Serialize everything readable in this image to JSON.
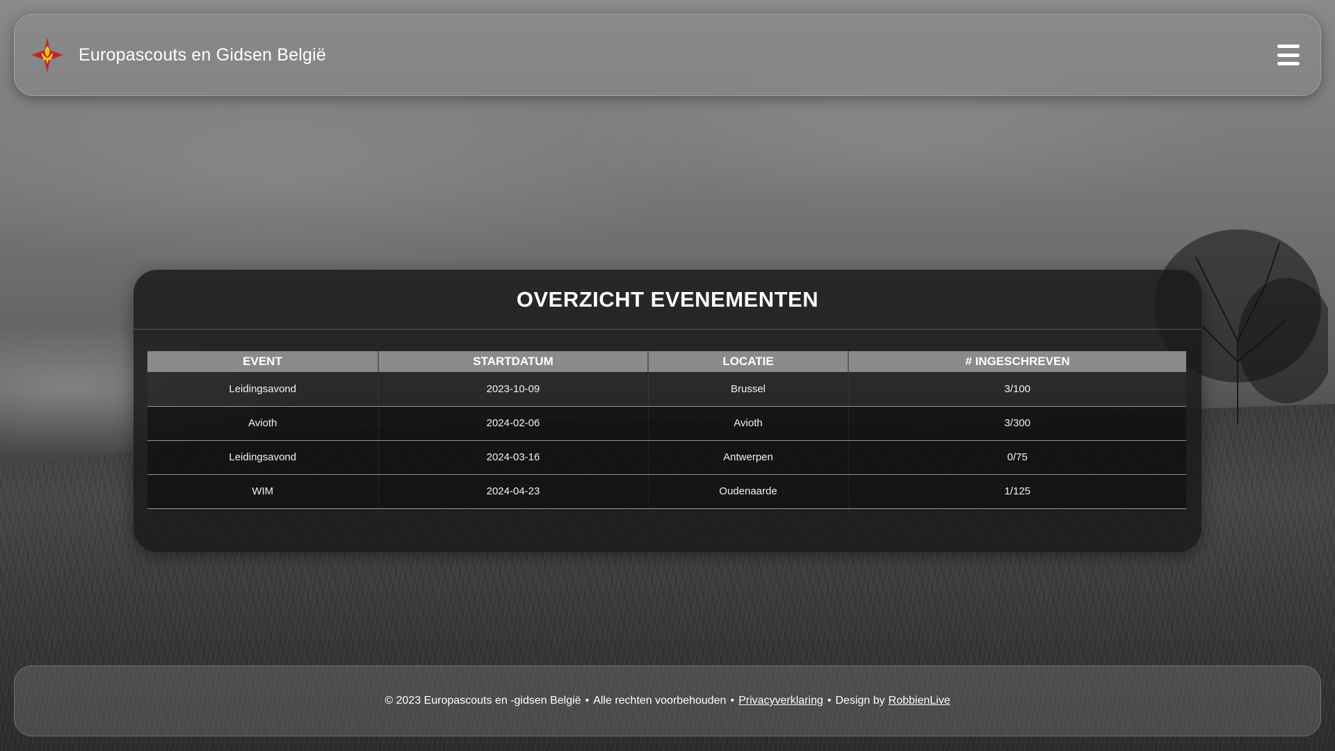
{
  "header": {
    "site_title": "Europascouts en Gidsen België",
    "logo_icon": "fleur-de-lis-star-icon",
    "menu_icon": "hamburger-menu-icon"
  },
  "events": {
    "title": "OVERZICHT EVENEMENTEN",
    "columns": [
      "EVENT",
      "STARTDATUM",
      "LOCATIE",
      "# INGESCHREVEN"
    ],
    "rows": [
      {
        "event": "Leidingsavond",
        "startdatum": "2023-10-09",
        "locatie": "Brussel",
        "ingeschreven": "3/100"
      },
      {
        "event": "Avioth",
        "startdatum": "2024-02-06",
        "locatie": "Avioth",
        "ingeschreven": "3/300"
      },
      {
        "event": "Leidingsavond",
        "startdatum": "2024-03-16",
        "locatie": "Antwerpen",
        "ingeschreven": "0/75"
      },
      {
        "event": "WIM",
        "startdatum": "2024-04-23",
        "locatie": "Oudenaarde",
        "ingeschreven": "1/125"
      }
    ]
  },
  "footer": {
    "copyright": "© 2023 Europascouts en -gidsen België",
    "rights": "Alle rechten voorbehouden",
    "separator": "•",
    "privacy_link": "Privacyverklaring",
    "design_prefix": "Design by",
    "designer_link": "RobbienLive"
  },
  "colors": {
    "accent_red": "#c62828",
    "logo_gold": "#f0c419",
    "header_row": "#8a8a8a"
  }
}
